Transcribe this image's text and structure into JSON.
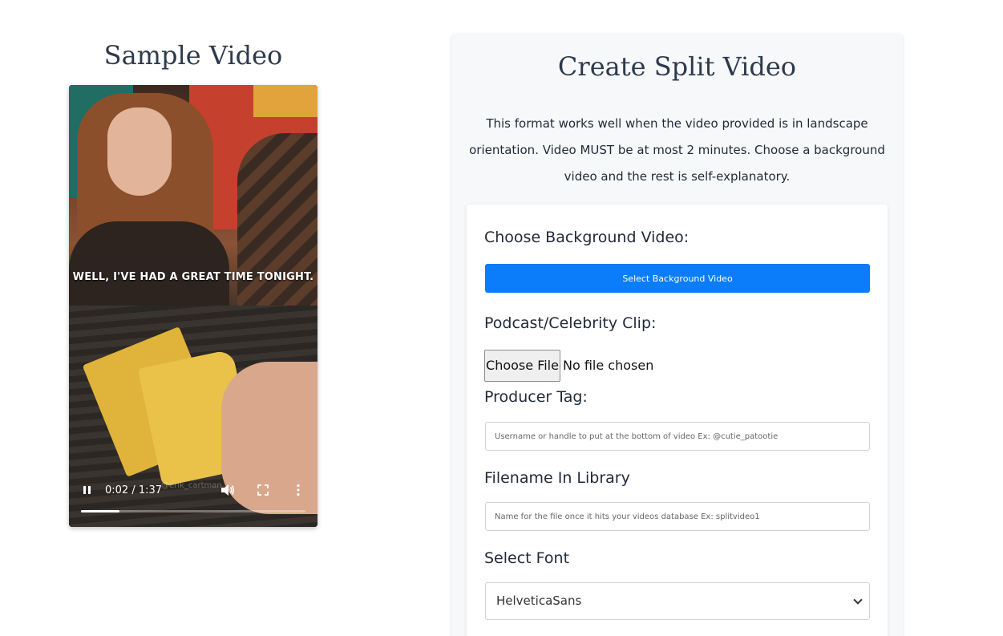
{
  "sample": {
    "title": "Sample Video",
    "caption": "WELL, I'VE HAD A GREAT TIME TONIGHT.",
    "watermark": "@erik_cartman",
    "time": "0:02 / 1:37",
    "progress": 0.17
  },
  "create": {
    "title": "Create Split Video",
    "description": "This format works well when the video provided is in landscape orientation. Video MUST be at most 2 minutes. Choose a background video and the rest is self-explanatory.",
    "background_label": "Choose Background Video:",
    "background_button": "Select Background Video",
    "clip_label": "Podcast/Celebrity Clip:",
    "choose_file_button": "Choose File",
    "no_file_text": "No file chosen",
    "producer_label": "Producer Tag:",
    "producer_placeholder": "Username or handle to put at the bottom of video Ex: @cutie_patootie",
    "filename_label": "Filename In Library",
    "filename_placeholder": "Name for the file once it hits your videos database Ex: splitvideo1",
    "font_label": "Select Font",
    "font_selected": "HelveticaSans"
  },
  "colors": {
    "accent": "#0b7dfa",
    "heading": "#2d3a4b",
    "card_bg": "#f7f8fa"
  }
}
